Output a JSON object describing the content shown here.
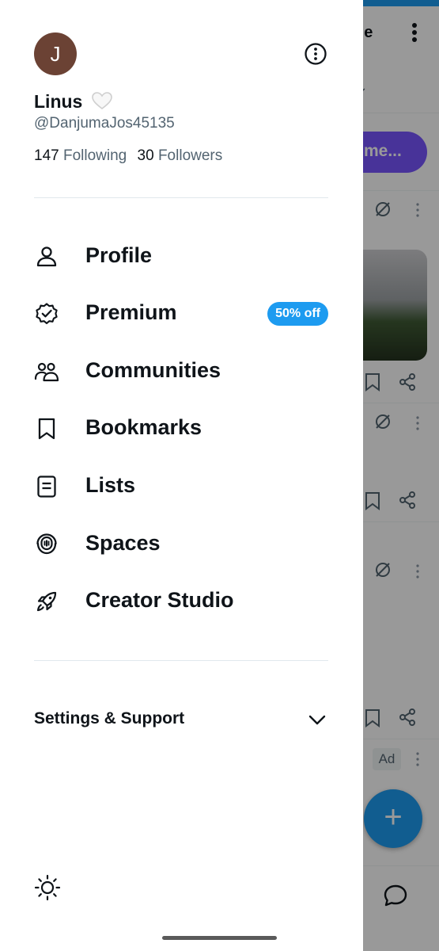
{
  "background": {
    "title": "de",
    "space_pill": "me...",
    "ad_label": "Ad",
    "fab_symbol": "+"
  },
  "profile": {
    "avatar_initial": "J",
    "display_name": "Linus",
    "handle": "@DanjumaJos45135",
    "following_count": "147",
    "following_label": "Following",
    "followers_count": "30",
    "followers_label": "Followers"
  },
  "menu": [
    {
      "label": "Profile",
      "icon": "person-icon"
    },
    {
      "label": "Premium",
      "icon": "verified-badge-icon",
      "badge": "50% off"
    },
    {
      "label": "Communities",
      "icon": "communities-icon"
    },
    {
      "label": "Bookmarks",
      "icon": "bookmark-icon"
    },
    {
      "label": "Lists",
      "icon": "list-icon"
    },
    {
      "label": "Spaces",
      "icon": "spaces-icon"
    },
    {
      "label": "Creator Studio",
      "icon": "rocket-icon"
    }
  ],
  "settings": {
    "label": "Settings & Support"
  },
  "colors": {
    "accent": "#1d9bf0",
    "text": "#0f1419",
    "muted": "#536471",
    "avatar_bg": "#6b4234",
    "spaces_purple": "#7856ff"
  }
}
